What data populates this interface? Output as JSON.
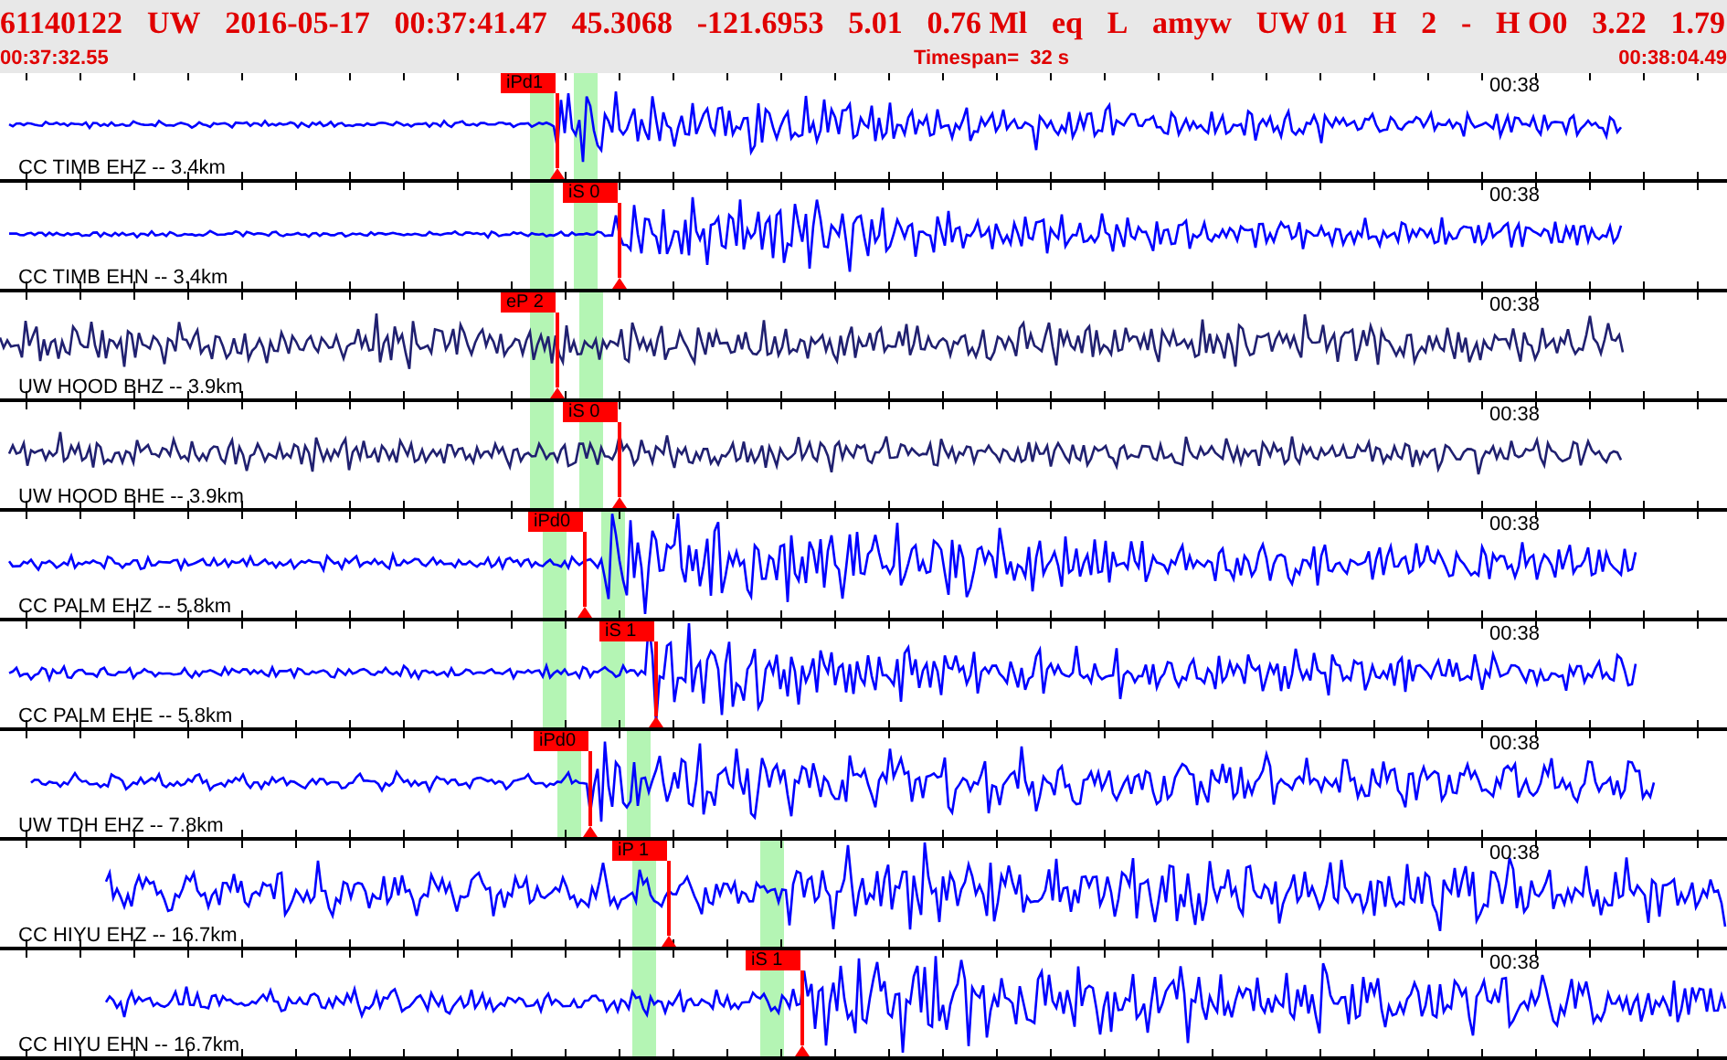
{
  "header": {
    "fields": [
      "61140122",
      "UW",
      "2016-05-17",
      "00:37:41.47",
      "45.3068",
      "-121.6953",
      "5.01",
      "0.76 Ml",
      "eq",
      "L",
      "amyw",
      "UW 01",
      "H",
      "2",
      "-",
      "H O0",
      "3.22",
      "1.79"
    ],
    "start_time": "00:37:32.55",
    "timespan": "Timespan=  32 s",
    "end_time": "00:38:04.49"
  },
  "traces": [
    {
      "station": "CC TIMB EHZ -- 3.4km",
      "pick": "iPd1",
      "time_label": "00:38",
      "color": "#0000ff"
    },
    {
      "station": "CC TIMB EHN -- 3.4km",
      "pick": "iS 0",
      "time_label": "00:38",
      "color": "#0000ff"
    },
    {
      "station": "UW HOOD BHZ -- 3.9km",
      "pick": "eP 2",
      "time_label": "00:38",
      "color": "#202070"
    },
    {
      "station": "UW HOOD BHE -- 3.9km",
      "pick": "iS 0",
      "time_label": "00:38",
      "color": "#202070"
    },
    {
      "station": "CC PALM EHZ -- 5.8km",
      "pick": "iPd0",
      "time_label": "00:38",
      "color": "#0000ff"
    },
    {
      "station": "CC PALM EHE -- 5.8km",
      "pick": "iS 1",
      "time_label": "00:38",
      "color": "#0000ff"
    },
    {
      "station": "UW TDH EHZ -- 7.8km",
      "pick": "iPd0",
      "time_label": "00:38",
      "color": "#0000ff"
    },
    {
      "station": "CC HIYU EHZ -- 16.7km",
      "pick": "iP 1",
      "time_label": "00:38",
      "color": "#0000ff"
    },
    {
      "station": "CC HIYU EHN -- 16.7km",
      "pick": "iS 1",
      "time_label": "00:38",
      "color": "#0000ff"
    }
  ]
}
